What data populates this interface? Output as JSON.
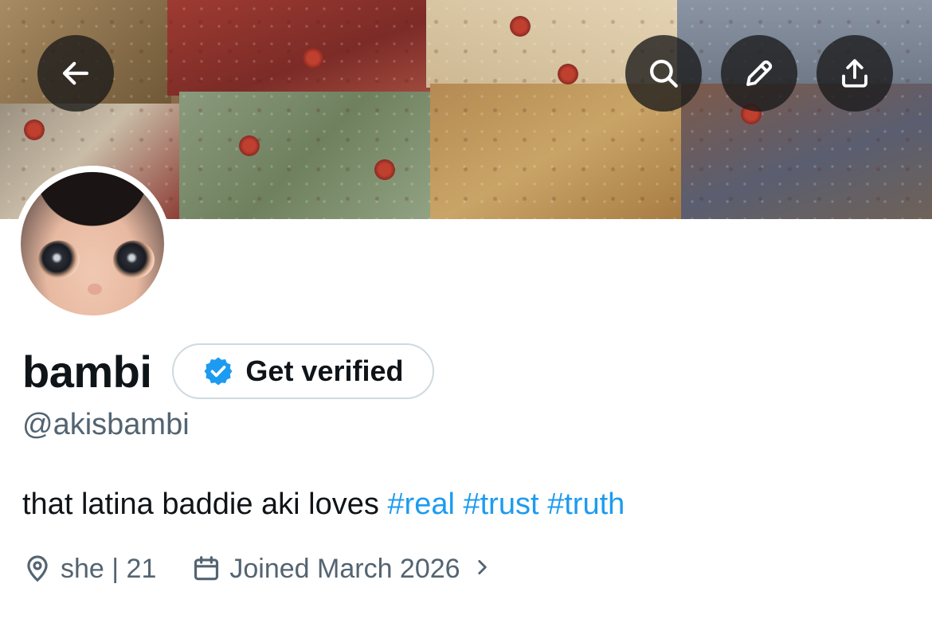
{
  "header": {
    "back_icon": "arrow-left-icon",
    "search_icon": "search-icon",
    "edit_icon": "pencil-icon",
    "share_icon": "share-upload-icon"
  },
  "profile": {
    "display_name": "bambi",
    "handle": "@akisbambi",
    "verify_button_label": "Get verified",
    "verify_icon": "verified-badge-icon",
    "verify_color": "#1d9bf0",
    "bio_text": "that latina baddie aki loves ",
    "bio_hashtags": [
      "#real",
      "#trust",
      "#truth"
    ],
    "location": "she | 21",
    "location_icon": "location-pin-icon",
    "joined": "Joined March 2026",
    "joined_icon": "calendar-icon"
  },
  "colors": {
    "text_primary": "#0f1419",
    "text_secondary": "#536471",
    "link": "#1d9bf0"
  }
}
